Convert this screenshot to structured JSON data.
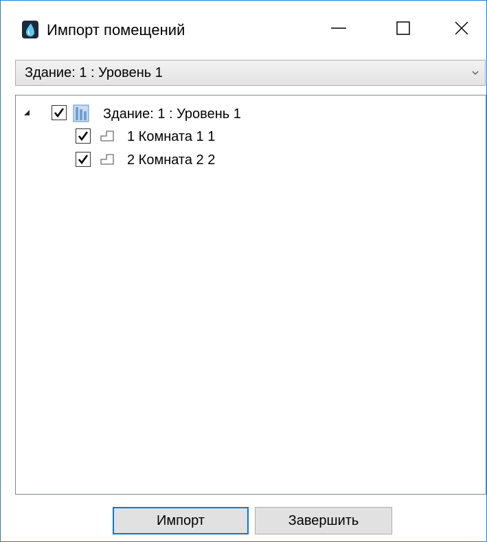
{
  "window": {
    "title": "Импорт помещений",
    "icon": "app-drop-icon",
    "controls": [
      "minimize-icon",
      "maximize-icon",
      "close-icon"
    ],
    "accent_color": "#1e7bd4"
  },
  "level_select": {
    "selected": "Здание: 1 : Уровень 1",
    "icon": "chevron-down-icon"
  },
  "tree": {
    "root": {
      "label": "Здание: 1 : Уровень 1",
      "checked": true,
      "expanded": true,
      "icon": "building-icon"
    },
    "children": [
      {
        "label": "1 Комната 1 1",
        "checked": true,
        "icon": "room-icon"
      },
      {
        "label": "2 Комната 2 2",
        "checked": true,
        "icon": "room-icon"
      }
    ]
  },
  "buttons": {
    "import_label": "Импорт",
    "finish_label": "Завершить"
  }
}
